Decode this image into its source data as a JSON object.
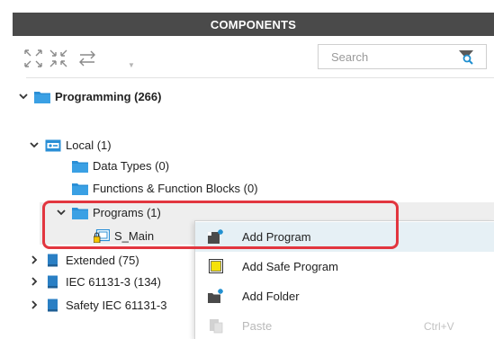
{
  "panel": {
    "title": "COMPONENTS"
  },
  "toolbar": {
    "icons": [
      "expand-all-icon",
      "collapse-all-icon",
      "swap-arrows-icon"
    ],
    "search": {
      "placeholder": "Search",
      "value": ""
    }
  },
  "tree": {
    "programming": {
      "label": "Programming (266)",
      "expanded": true
    },
    "local": {
      "label": "Local (1)",
      "expanded": true
    },
    "data_types": {
      "label": "Data Types (0)"
    },
    "functions": {
      "label": "Functions & Function Blocks (0)"
    },
    "programs": {
      "label": "Programs (1)",
      "expanded": true
    },
    "s_main": {
      "label": "S_Main"
    },
    "extended": {
      "label": "Extended (75)",
      "expanded": false
    },
    "iec": {
      "label": "IEC 61131-3 (134)",
      "expanded": false
    },
    "safety_iec": {
      "label": "Safety IEC 61131-3",
      "expanded": false
    }
  },
  "context_menu": {
    "items": [
      {
        "label": "Add Program",
        "icon": "add-program-icon",
        "active": true
      },
      {
        "label": "Add Safe Program",
        "icon": "safe-program-icon"
      },
      {
        "label": "Add Folder",
        "icon": "add-folder-icon"
      },
      {
        "label": "Paste",
        "shortcut": "Ctrl+V",
        "icon": "paste-icon",
        "disabled": true
      }
    ]
  },
  "colors": {
    "header_bg": "#4a4a4a",
    "folder_blue": "#2a8fd6",
    "highlight_red": "#e2363f",
    "menu_active_bg": "#e6f0f5",
    "safe_yellow": "#f5e10a"
  }
}
